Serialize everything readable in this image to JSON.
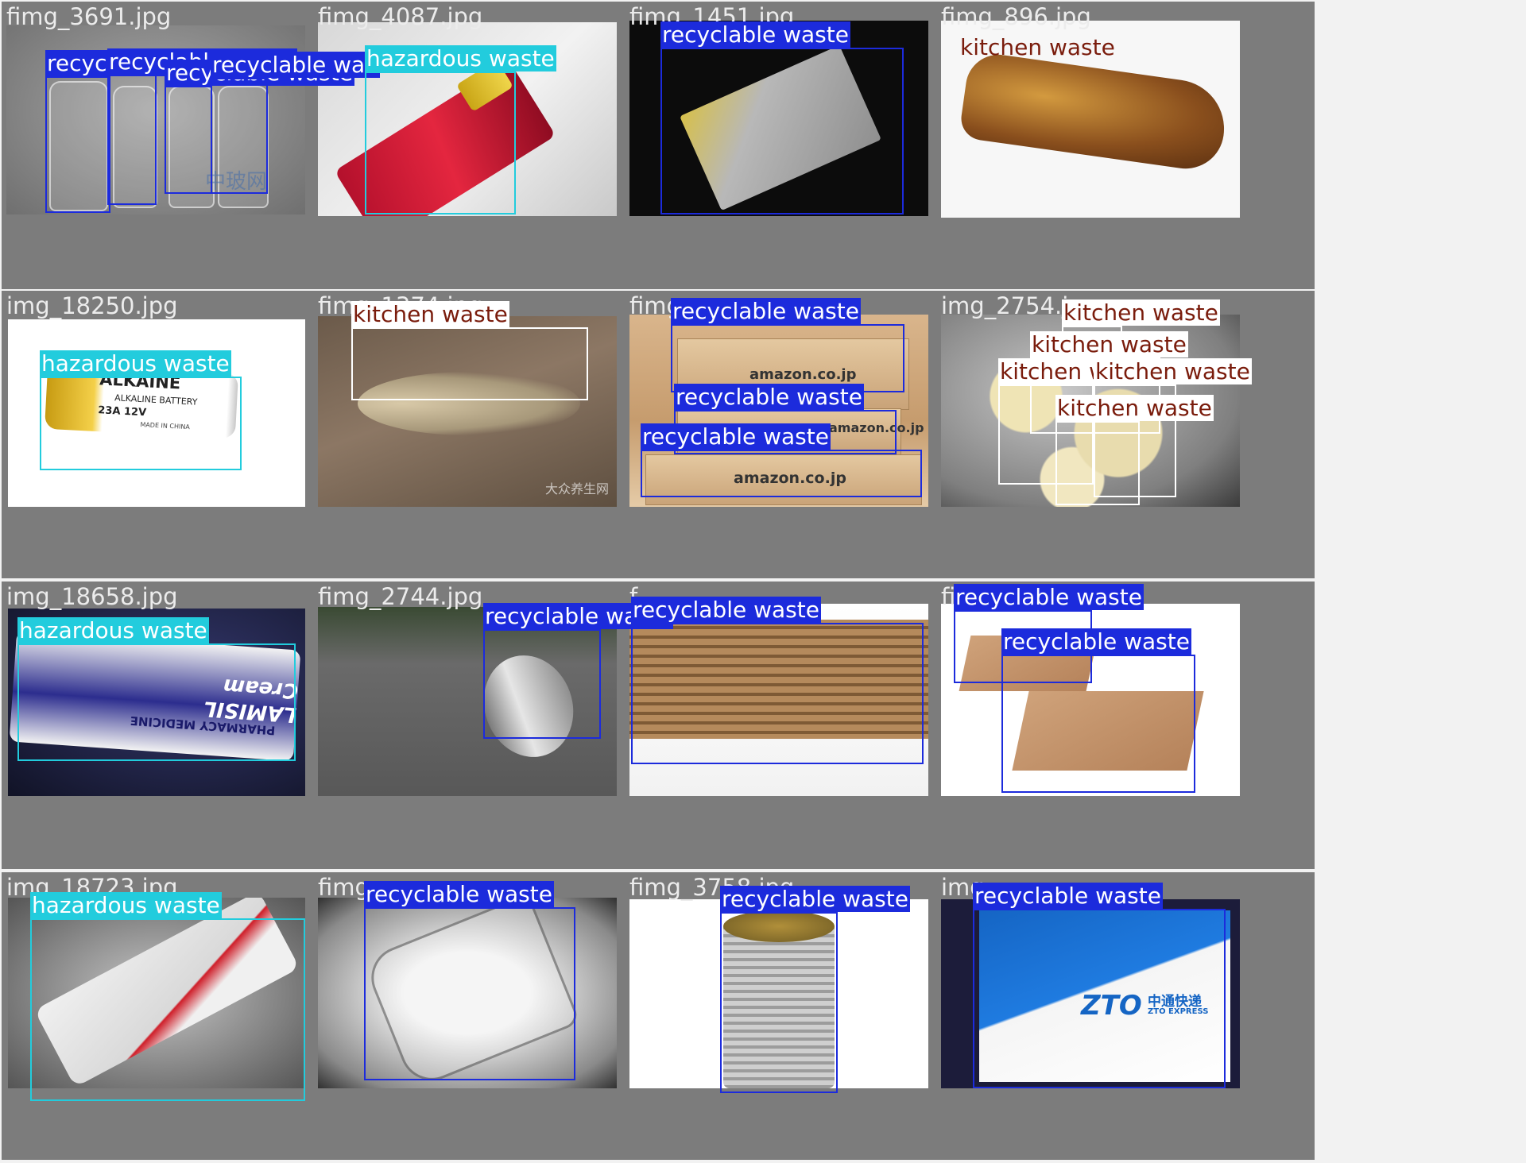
{
  "tiles": [
    {
      "filename": "fimg_3691.jpg",
      "detections": [
        {
          "label": "recyclable waste",
          "class": "recyclable"
        },
        {
          "label": "recyclable waste",
          "class": "recyclable"
        },
        {
          "label": "recyclable waste",
          "class": "recyclable"
        },
        {
          "label": "recyclable waste",
          "class": "recyclable"
        }
      ],
      "watermark": "中玻网"
    },
    {
      "filename": "fimg_4087.jpg",
      "detections": [
        {
          "label": "hazardous waste",
          "class": "hazardous"
        }
      ]
    },
    {
      "filename": "fimg_1451.jpg",
      "detections": [
        {
          "label": "recyclable waste",
          "class": "recyclable"
        }
      ]
    },
    {
      "filename": "fimg_896.jpg",
      "detections": [
        {
          "label": "kitchen waste",
          "class": "kitchen"
        }
      ]
    },
    {
      "filename": "img_18250.jpg",
      "detections": [
        {
          "label": "hazardous waste",
          "class": "hazardous"
        }
      ],
      "product_text": [
        "ALKAINE",
        "ALKALINE BATTERY",
        "23A 12V",
        "MADE IN CHINA"
      ]
    },
    {
      "filename": "fimg_1374.jpg",
      "detections": [
        {
          "label": "kitchen waste",
          "class": "kitchen"
        }
      ],
      "watermark": "大众养生网"
    },
    {
      "filename": "fimg_",
      "detections": [
        {
          "label": "recyclable waste",
          "class": "recyclable"
        },
        {
          "label": "recyclable waste",
          "class": "recyclable"
        },
        {
          "label": "recyclable waste",
          "class": "recyclable"
        }
      ],
      "product_text": [
        "amazon.co.jp",
        "amazon.co.jp",
        "amazon.co.jp"
      ]
    },
    {
      "filename": "img_2754.jpg",
      "detections": [
        {
          "label": "kitchen waste",
          "class": "kitchen"
        },
        {
          "label": "kitchen waste",
          "class": "kitchen"
        },
        {
          "label": "kitchen waste",
          "class": "kitchen"
        },
        {
          "label": "kitchen waste",
          "class": "kitchen"
        },
        {
          "label": "kitchen waste",
          "class": "kitchen"
        }
      ]
    },
    {
      "filename": "img_18658.jpg",
      "detections": [
        {
          "label": "hazardous waste",
          "class": "hazardous"
        }
      ],
      "product_text": [
        "LAMISIL Cream",
        "PHARMACY MEDICINE"
      ]
    },
    {
      "filename": "fimg_2744.jpg",
      "detections": [
        {
          "label": "recyclable waste",
          "class": "recyclable"
        }
      ]
    },
    {
      "filename": "f",
      "detections": [
        {
          "label": "recyclable waste",
          "class": "recyclable"
        }
      ]
    },
    {
      "filename": "fi",
      "detections": [
        {
          "label": "recyclable waste",
          "class": "recyclable"
        },
        {
          "label": "recyclable waste",
          "class": "recyclable"
        }
      ]
    },
    {
      "filename": "img_18723.jpg",
      "detections": [
        {
          "label": "hazardous waste",
          "class": "hazardous"
        }
      ]
    },
    {
      "filename": "fimg_",
      "detections": [
        {
          "label": "recyclable waste",
          "class": "recyclable"
        }
      ]
    },
    {
      "filename": "fimg_3758.jpg",
      "detections": [
        {
          "label": "recyclable waste",
          "class": "recyclable"
        }
      ]
    },
    {
      "filename": "img",
      "detections": [
        {
          "label": "recyclable waste",
          "class": "recyclable"
        }
      ],
      "product_text": [
        "ZTO",
        "中通快递",
        "ZTO EXPRESS"
      ]
    }
  ],
  "colors": {
    "recyclable": "#1c2bdc",
    "hazardous": "#22ccdd",
    "kitchen": "#ffffff",
    "kitchen_text": "#7a1c0c",
    "tile_background": "#7c7c7c"
  }
}
